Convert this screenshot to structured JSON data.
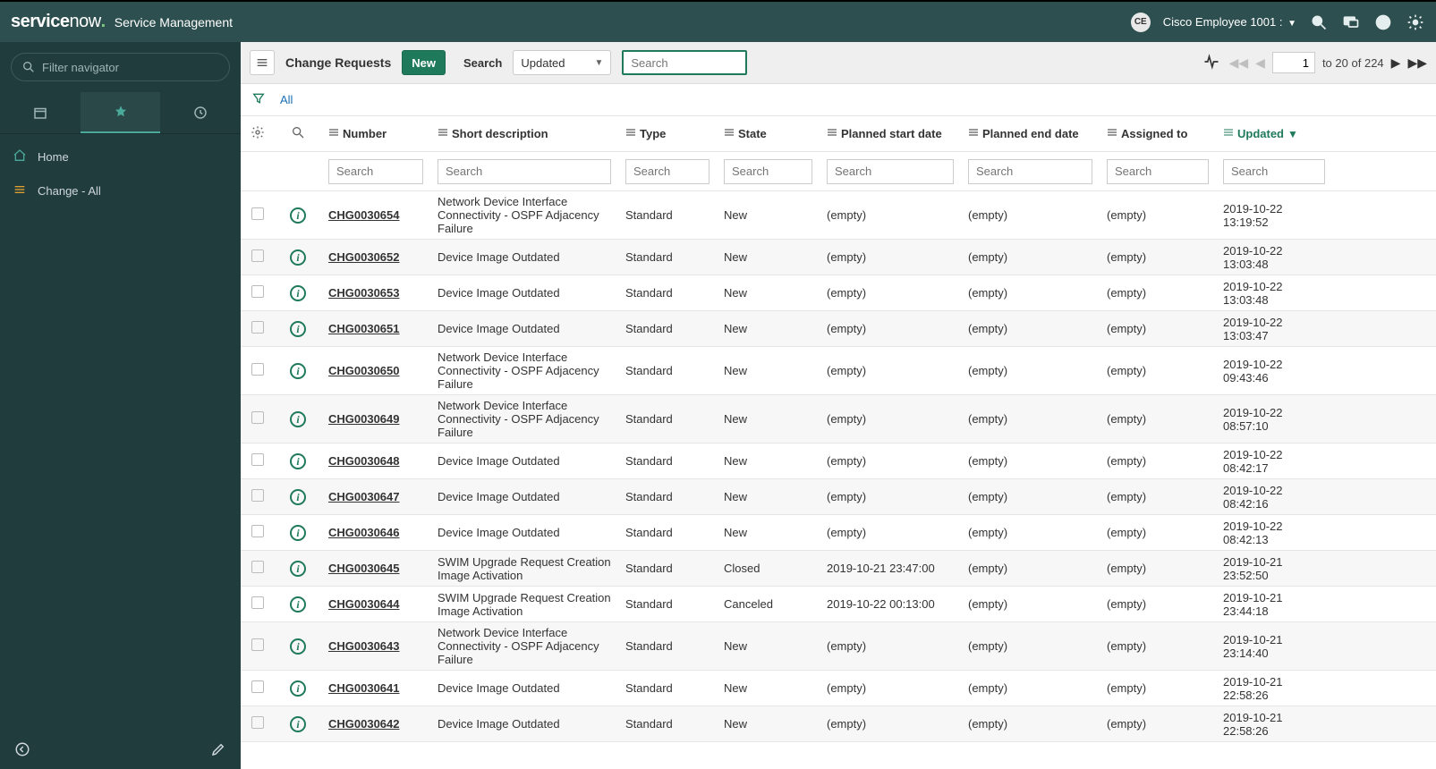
{
  "banner": {
    "logo_main": "service",
    "logo_now": "now",
    "app_title": "Service Management",
    "user_initials": "CE",
    "user_name": "Cisco Employee 1001 :"
  },
  "sidebar": {
    "filter_placeholder": "Filter navigator",
    "nav": [
      {
        "key": "home",
        "label": "Home"
      },
      {
        "key": "change-all",
        "label": "Change - All"
      }
    ]
  },
  "toolbar": {
    "title": "Change Requests",
    "new_label": "New",
    "search_label": "Search",
    "search_field_selected": "Updated",
    "search_placeholder": "Search",
    "page_current": "1",
    "page_range_prefix": "to",
    "page_range_mid": "of",
    "page_to": "20",
    "page_total": "224"
  },
  "filter": {
    "all_label": "All"
  },
  "columns": {
    "number": "Number",
    "short_desc": "Short description",
    "type": "Type",
    "state": "State",
    "planned_start": "Planned start date",
    "planned_end": "Planned end date",
    "assigned_to": "Assigned to",
    "updated": "Updated"
  },
  "search_placeholder": "Search",
  "rows": [
    {
      "number": "CHG0030654",
      "desc": "Network Device Interface Connectivity - OSPF Adjacency Failure",
      "type": "Standard",
      "state": "New",
      "pstart": "(empty)",
      "pend": "(empty)",
      "assigned": "(empty)",
      "updated": "2019-10-22 13:19:52"
    },
    {
      "number": "CHG0030652",
      "desc": "Device Image Outdated",
      "type": "Standard",
      "state": "New",
      "pstart": "(empty)",
      "pend": "(empty)",
      "assigned": "(empty)",
      "updated": "2019-10-22 13:03:48"
    },
    {
      "number": "CHG0030653",
      "desc": "Device Image Outdated",
      "type": "Standard",
      "state": "New",
      "pstart": "(empty)",
      "pend": "(empty)",
      "assigned": "(empty)",
      "updated": "2019-10-22 13:03:48"
    },
    {
      "number": "CHG0030651",
      "desc": "Device Image Outdated",
      "type": "Standard",
      "state": "New",
      "pstart": "(empty)",
      "pend": "(empty)",
      "assigned": "(empty)",
      "updated": "2019-10-22 13:03:47"
    },
    {
      "number": "CHG0030650",
      "desc": "Network Device Interface Connectivity - OSPF Adjacency Failure",
      "type": "Standard",
      "state": "New",
      "pstart": "(empty)",
      "pend": "(empty)",
      "assigned": "(empty)",
      "updated": "2019-10-22 09:43:46"
    },
    {
      "number": "CHG0030649",
      "desc": "Network Device Interface Connectivity - OSPF Adjacency Failure",
      "type": "Standard",
      "state": "New",
      "pstart": "(empty)",
      "pend": "(empty)",
      "assigned": "(empty)",
      "updated": "2019-10-22 08:57:10"
    },
    {
      "number": "CHG0030648",
      "desc": "Device Image Outdated",
      "type": "Standard",
      "state": "New",
      "pstart": "(empty)",
      "pend": "(empty)",
      "assigned": "(empty)",
      "updated": "2019-10-22 08:42:17"
    },
    {
      "number": "CHG0030647",
      "desc": "Device Image Outdated",
      "type": "Standard",
      "state": "New",
      "pstart": "(empty)",
      "pend": "(empty)",
      "assigned": "(empty)",
      "updated": "2019-10-22 08:42:16"
    },
    {
      "number": "CHG0030646",
      "desc": "Device Image Outdated",
      "type": "Standard",
      "state": "New",
      "pstart": "(empty)",
      "pend": "(empty)",
      "assigned": "(empty)",
      "updated": "2019-10-22 08:42:13"
    },
    {
      "number": "CHG0030645",
      "desc": "SWIM Upgrade Request Creation Image Activation",
      "type": "Standard",
      "state": "Closed",
      "pstart": "2019-10-21 23:47:00",
      "pend": "(empty)",
      "assigned": "(empty)",
      "updated": "2019-10-21 23:52:50"
    },
    {
      "number": "CHG0030644",
      "desc": "SWIM Upgrade Request Creation Image Activation",
      "type": "Standard",
      "state": "Canceled",
      "pstart": "2019-10-22 00:13:00",
      "pend": "(empty)",
      "assigned": "(empty)",
      "updated": "2019-10-21 23:44:18"
    },
    {
      "number": "CHG0030643",
      "desc": "Network Device Interface Connectivity - OSPF Adjacency Failure",
      "type": "Standard",
      "state": "New",
      "pstart": "(empty)",
      "pend": "(empty)",
      "assigned": "(empty)",
      "updated": "2019-10-21 23:14:40"
    },
    {
      "number": "CHG0030641",
      "desc": "Device Image Outdated",
      "type": "Standard",
      "state": "New",
      "pstart": "(empty)",
      "pend": "(empty)",
      "assigned": "(empty)",
      "updated": "2019-10-21 22:58:26"
    },
    {
      "number": "CHG0030642",
      "desc": "Device Image Outdated",
      "type": "Standard",
      "state": "New",
      "pstart": "(empty)",
      "pend": "(empty)",
      "assigned": "(empty)",
      "updated": "2019-10-21 22:58:26"
    }
  ]
}
